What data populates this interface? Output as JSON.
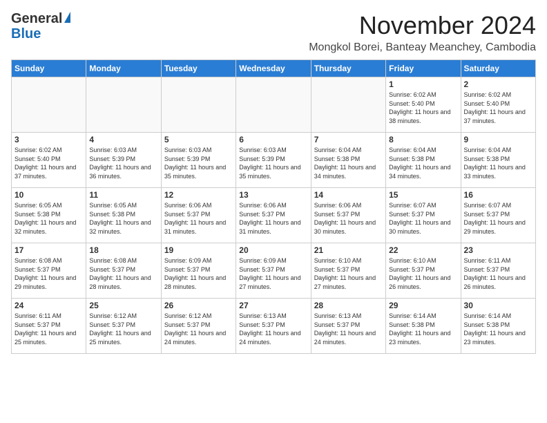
{
  "header": {
    "logo_general": "General",
    "logo_blue": "Blue",
    "month_title": "November 2024",
    "location": "Mongkol Borei, Banteay Meanchey, Cambodia"
  },
  "days_of_week": [
    "Sunday",
    "Monday",
    "Tuesday",
    "Wednesday",
    "Thursday",
    "Friday",
    "Saturday"
  ],
  "weeks": [
    [
      {
        "day": "",
        "info": ""
      },
      {
        "day": "",
        "info": ""
      },
      {
        "day": "",
        "info": ""
      },
      {
        "day": "",
        "info": ""
      },
      {
        "day": "",
        "info": ""
      },
      {
        "day": "1",
        "info": "Sunrise: 6:02 AM\nSunset: 5:40 PM\nDaylight: 11 hours and 38 minutes."
      },
      {
        "day": "2",
        "info": "Sunrise: 6:02 AM\nSunset: 5:40 PM\nDaylight: 11 hours and 37 minutes."
      }
    ],
    [
      {
        "day": "3",
        "info": "Sunrise: 6:02 AM\nSunset: 5:40 PM\nDaylight: 11 hours and 37 minutes."
      },
      {
        "day": "4",
        "info": "Sunrise: 6:03 AM\nSunset: 5:39 PM\nDaylight: 11 hours and 36 minutes."
      },
      {
        "day": "5",
        "info": "Sunrise: 6:03 AM\nSunset: 5:39 PM\nDaylight: 11 hours and 35 minutes."
      },
      {
        "day": "6",
        "info": "Sunrise: 6:03 AM\nSunset: 5:39 PM\nDaylight: 11 hours and 35 minutes."
      },
      {
        "day": "7",
        "info": "Sunrise: 6:04 AM\nSunset: 5:38 PM\nDaylight: 11 hours and 34 minutes."
      },
      {
        "day": "8",
        "info": "Sunrise: 6:04 AM\nSunset: 5:38 PM\nDaylight: 11 hours and 34 minutes."
      },
      {
        "day": "9",
        "info": "Sunrise: 6:04 AM\nSunset: 5:38 PM\nDaylight: 11 hours and 33 minutes."
      }
    ],
    [
      {
        "day": "10",
        "info": "Sunrise: 6:05 AM\nSunset: 5:38 PM\nDaylight: 11 hours and 32 minutes."
      },
      {
        "day": "11",
        "info": "Sunrise: 6:05 AM\nSunset: 5:38 PM\nDaylight: 11 hours and 32 minutes."
      },
      {
        "day": "12",
        "info": "Sunrise: 6:06 AM\nSunset: 5:37 PM\nDaylight: 11 hours and 31 minutes."
      },
      {
        "day": "13",
        "info": "Sunrise: 6:06 AM\nSunset: 5:37 PM\nDaylight: 11 hours and 31 minutes."
      },
      {
        "day": "14",
        "info": "Sunrise: 6:06 AM\nSunset: 5:37 PM\nDaylight: 11 hours and 30 minutes."
      },
      {
        "day": "15",
        "info": "Sunrise: 6:07 AM\nSunset: 5:37 PM\nDaylight: 11 hours and 30 minutes."
      },
      {
        "day": "16",
        "info": "Sunrise: 6:07 AM\nSunset: 5:37 PM\nDaylight: 11 hours and 29 minutes."
      }
    ],
    [
      {
        "day": "17",
        "info": "Sunrise: 6:08 AM\nSunset: 5:37 PM\nDaylight: 11 hours and 29 minutes."
      },
      {
        "day": "18",
        "info": "Sunrise: 6:08 AM\nSunset: 5:37 PM\nDaylight: 11 hours and 28 minutes."
      },
      {
        "day": "19",
        "info": "Sunrise: 6:09 AM\nSunset: 5:37 PM\nDaylight: 11 hours and 28 minutes."
      },
      {
        "day": "20",
        "info": "Sunrise: 6:09 AM\nSunset: 5:37 PM\nDaylight: 11 hours and 27 minutes."
      },
      {
        "day": "21",
        "info": "Sunrise: 6:10 AM\nSunset: 5:37 PM\nDaylight: 11 hours and 27 minutes."
      },
      {
        "day": "22",
        "info": "Sunrise: 6:10 AM\nSunset: 5:37 PM\nDaylight: 11 hours and 26 minutes."
      },
      {
        "day": "23",
        "info": "Sunrise: 6:11 AM\nSunset: 5:37 PM\nDaylight: 11 hours and 26 minutes."
      }
    ],
    [
      {
        "day": "24",
        "info": "Sunrise: 6:11 AM\nSunset: 5:37 PM\nDaylight: 11 hours and 25 minutes."
      },
      {
        "day": "25",
        "info": "Sunrise: 6:12 AM\nSunset: 5:37 PM\nDaylight: 11 hours and 25 minutes."
      },
      {
        "day": "26",
        "info": "Sunrise: 6:12 AM\nSunset: 5:37 PM\nDaylight: 11 hours and 24 minutes."
      },
      {
        "day": "27",
        "info": "Sunrise: 6:13 AM\nSunset: 5:37 PM\nDaylight: 11 hours and 24 minutes."
      },
      {
        "day": "28",
        "info": "Sunrise: 6:13 AM\nSunset: 5:37 PM\nDaylight: 11 hours and 24 minutes."
      },
      {
        "day": "29",
        "info": "Sunrise: 6:14 AM\nSunset: 5:38 PM\nDaylight: 11 hours and 23 minutes."
      },
      {
        "day": "30",
        "info": "Sunrise: 6:14 AM\nSunset: 5:38 PM\nDaylight: 11 hours and 23 minutes."
      }
    ]
  ]
}
